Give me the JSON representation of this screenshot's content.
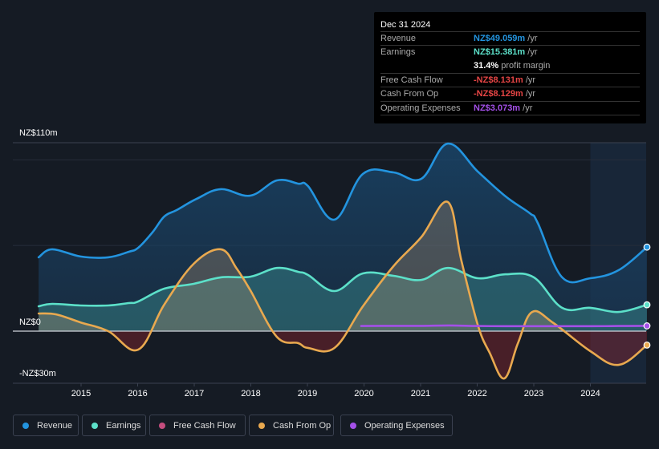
{
  "tooltip": {
    "date": "Dec 31 2024",
    "rows": [
      {
        "label": "Revenue",
        "value": "NZ$49.059m",
        "unit": " /yr",
        "color": "#2394df"
      },
      {
        "label": "Earnings",
        "value": "NZ$15.381m",
        "unit": " /yr",
        "color": "#5ce0c9"
      },
      {
        "label": "",
        "value": "31.4%",
        "unit": " profit margin",
        "color": "#ffffff"
      },
      {
        "label": "Free Cash Flow",
        "value": "-NZ$8.131m",
        "unit": " /yr",
        "color": "#e64545"
      },
      {
        "label": "Cash From Op",
        "value": "-NZ$8.129m",
        "unit": " /yr",
        "color": "#e64545"
      },
      {
        "label": "Operating Expenses",
        "value": "NZ$3.073m",
        "unit": " /yr",
        "color": "#a450e8"
      }
    ]
  },
  "chart_data": {
    "type": "area",
    "title": "",
    "xlabel": "",
    "ylabel": "",
    "ylim": [
      -30,
      110
    ],
    "xlim": [
      2014.25,
      2025.0
    ],
    "y_tick_labels": [
      {
        "value": 110,
        "label": "NZ$110m"
      },
      {
        "value": 0,
        "label": "NZ$0"
      },
      {
        "value": -30,
        "label": "-NZ$30m"
      }
    ],
    "gridlines": [
      100,
      50
    ],
    "x_tick_labels": [
      "2015",
      "2016",
      "2017",
      "2018",
      "2019",
      "2020",
      "2021",
      "2022",
      "2023",
      "2024"
    ],
    "highlight_from": 2024.0,
    "legend_position": "bottom-left",
    "series": [
      {
        "name": "Revenue",
        "color": "#2394df",
        "x": [
          2014.25,
          2014.49,
          2014.99,
          2015.48,
          2015.84,
          2016.01,
          2016.26,
          2016.47,
          2016.69,
          2017.04,
          2017.47,
          2017.99,
          2018.46,
          2018.84,
          2019.01,
          2019.48,
          2019.98,
          2020.52,
          2021.01,
          2021.48,
          2022.01,
          2022.5,
          2022.93,
          2023.07,
          2023.5,
          2024.0,
          2024.5,
          2025.0
        ],
        "values": [
          43.1,
          47.8,
          43.6,
          43.1,
          46.3,
          48.7,
          57.6,
          66.9,
          70.7,
          77.2,
          82.9,
          79.1,
          88.0,
          86.1,
          84.7,
          65.1,
          91.8,
          92.7,
          88.9,
          109.5,
          93.2,
          78.7,
          68.8,
          63.2,
          31.4,
          30.9,
          35.6,
          49.06
        ]
      },
      {
        "name": "Earnings",
        "color": "#5ce0c9",
        "x": [
          2014.25,
          2014.49,
          2014.99,
          2015.48,
          2015.84,
          2016.01,
          2016.47,
          2016.99,
          2017.47,
          2017.99,
          2018.46,
          2018.84,
          2019.01,
          2019.48,
          2019.98,
          2020.52,
          2021.01,
          2021.48,
          2022.01,
          2022.5,
          2023.0,
          2023.5,
          2024.0,
          2024.5,
          2025.0
        ],
        "values": [
          14.5,
          15.9,
          15.0,
          15.0,
          16.4,
          17.3,
          24.8,
          27.6,
          31.4,
          31.8,
          36.9,
          34.6,
          32.8,
          23.4,
          33.7,
          32.3,
          29.9,
          36.9,
          30.9,
          33.2,
          31.4,
          13.6,
          13.6,
          11.2,
          15.38
        ]
      },
      {
        "name": "Free Cash Flow",
        "color": "#c44d7e",
        "x": [
          2014.25,
          2014.56,
          2014.99,
          2015.48,
          2016.01,
          2016.47,
          2016.99,
          2017.47,
          2017.75,
          2017.99,
          2018.46,
          2018.84,
          2019.01,
          2019.48,
          2019.98,
          2020.52,
          2021.01,
          2021.48,
          2021.72,
          2022.01,
          2022.22,
          2022.48,
          2022.72,
          2022.97,
          2023.35,
          2024.0,
          2024.5,
          2025.0
        ],
        "values": [
          10.3,
          9.8,
          5.1,
          0,
          -10.8,
          15.5,
          39.3,
          47.8,
          36.5,
          23.9,
          -3.3,
          -7.0,
          -9.8,
          -9.8,
          14.5,
          37.9,
          54.8,
          75.4,
          41.2,
          3.7,
          -12.6,
          -27.6,
          -7.0,
          11.2,
          4.7,
          -11.7,
          -19.7,
          -8.13
        ]
      },
      {
        "name": "Cash From Op",
        "color": "#e9a94f",
        "x": [
          2014.25,
          2014.56,
          2014.99,
          2015.48,
          2016.01,
          2016.47,
          2016.99,
          2017.47,
          2017.75,
          2017.99,
          2018.46,
          2018.84,
          2019.01,
          2019.48,
          2019.98,
          2020.52,
          2021.01,
          2021.48,
          2021.72,
          2022.01,
          2022.22,
          2022.48,
          2022.72,
          2022.97,
          2023.35,
          2024.0,
          2024.5,
          2025.0
        ],
        "values": [
          10.3,
          9.8,
          5.1,
          0,
          -10.8,
          15.5,
          39.3,
          47.8,
          36.5,
          23.9,
          -3.3,
          -7.0,
          -9.8,
          -9.8,
          14.5,
          37.9,
          54.8,
          75.4,
          41.2,
          3.7,
          -12.6,
          -27.6,
          -7.0,
          11.2,
          4.7,
          -11.7,
          -19.7,
          -8.13
        ]
      },
      {
        "name": "Operating Expenses",
        "color": "#a450e8",
        "x": [
          2019.95,
          2020.5,
          2021.0,
          2021.5,
          2022.0,
          2022.5,
          2023.0,
          2023.5,
          2024.0,
          2024.5,
          2025.0
        ],
        "values": [
          3.0,
          3.1,
          3.1,
          3.3,
          3.0,
          2.9,
          2.9,
          2.9,
          2.9,
          3.0,
          3.07
        ]
      }
    ]
  },
  "legend": [
    {
      "label": "Revenue",
      "color": "#2394df"
    },
    {
      "label": "Earnings",
      "color": "#5ce0c9"
    },
    {
      "label": "Free Cash Flow",
      "color": "#c44d7e"
    },
    {
      "label": "Cash From Op",
      "color": "#e9a94f"
    },
    {
      "label": "Operating Expenses",
      "color": "#a450e8"
    }
  ]
}
